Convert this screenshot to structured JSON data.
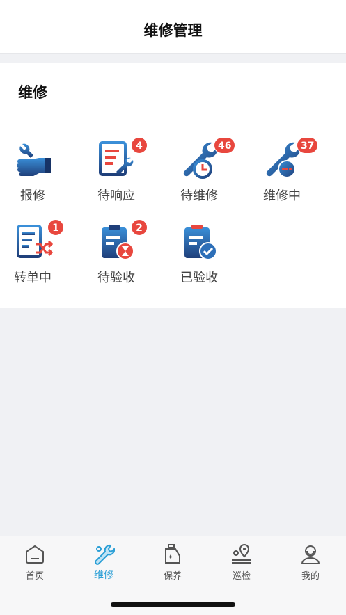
{
  "nav": {
    "title": "维修管理"
  },
  "section": {
    "title": "维修",
    "items": [
      {
        "label": "报修",
        "icon": "hand-wrench-icon",
        "badge": ""
      },
      {
        "label": "待响应",
        "icon": "document-wrench-icon",
        "badge": "4"
      },
      {
        "label": "待维修",
        "icon": "wrench-clock-icon",
        "badge": "46"
      },
      {
        "label": "维修中",
        "icon": "wrench-dots-icon",
        "badge": "37"
      },
      {
        "label": "转单中",
        "icon": "document-shuffle-icon",
        "badge": "1"
      },
      {
        "label": "待验收",
        "icon": "clipboard-hourglass-icon",
        "badge": "2"
      },
      {
        "label": "已验收",
        "icon": "clipboard-check-icon",
        "badge": ""
      }
    ]
  },
  "tabbar": {
    "items": [
      {
        "label": "首页",
        "icon": "home-icon",
        "active": false
      },
      {
        "label": "维修",
        "icon": "wrench-icon",
        "active": true
      },
      {
        "label": "保养",
        "icon": "oil-can-icon",
        "active": false
      },
      {
        "label": "巡检",
        "icon": "location-pin-icon",
        "active": false
      },
      {
        "label": "我的",
        "icon": "user-icon",
        "active": false
      }
    ]
  },
  "colors": {
    "accent": "#2b9fd6",
    "badge": "#e8473e",
    "icon_dark": "#1f4f8f",
    "icon_light": "#3a8fd8"
  }
}
